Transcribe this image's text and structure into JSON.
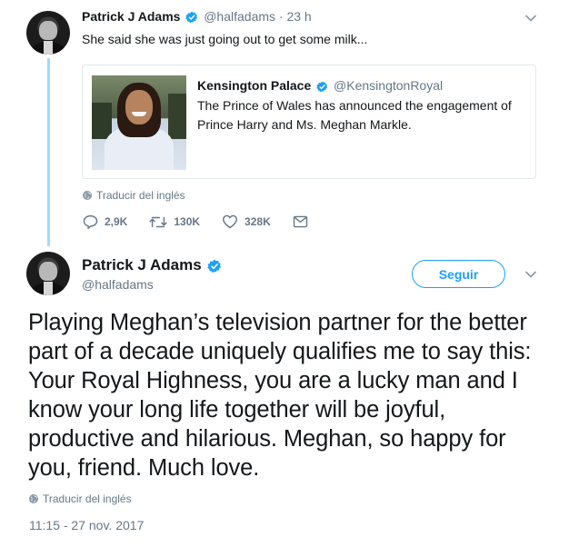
{
  "parent_tweet": {
    "author_name": "Patrick J Adams",
    "author_handle": "@halfadams",
    "time": "· 23 h",
    "text": "She said she was just going out to get some milk...",
    "quoted_tweet": {
      "author_name": "Kensington Palace",
      "author_handle": "@KensingtonRoyal",
      "text_line1": "The Prince of Wales has announced the engagement of",
      "text_line2": "Prince Harry and Ms. Meghan Markle."
    },
    "translate_label": "Traducir del inglés",
    "actions": {
      "replies": "2,9K",
      "retweets": "130K",
      "likes": "328K"
    }
  },
  "main_tweet": {
    "author_name": "Patrick J Adams",
    "author_handle": "@halfadams",
    "follow_label": "Seguir",
    "text": "Playing Meghan’s television partner for the better part of a decade uniquely qualifies me to say this: Your Royal Highness, you are a lucky man and I know your long life together will be joyful, productive and hilarious. Meghan, so happy for you, friend. Much love.",
    "translate_label": "Traducir del inglés",
    "timestamp": "11:15 - 27 nov. 2017"
  },
  "colors": {
    "accent": "#1da1f2",
    "thread_line": "#a3d9f5",
    "secondary_text": "#657786",
    "border": "#e1e8ed"
  }
}
